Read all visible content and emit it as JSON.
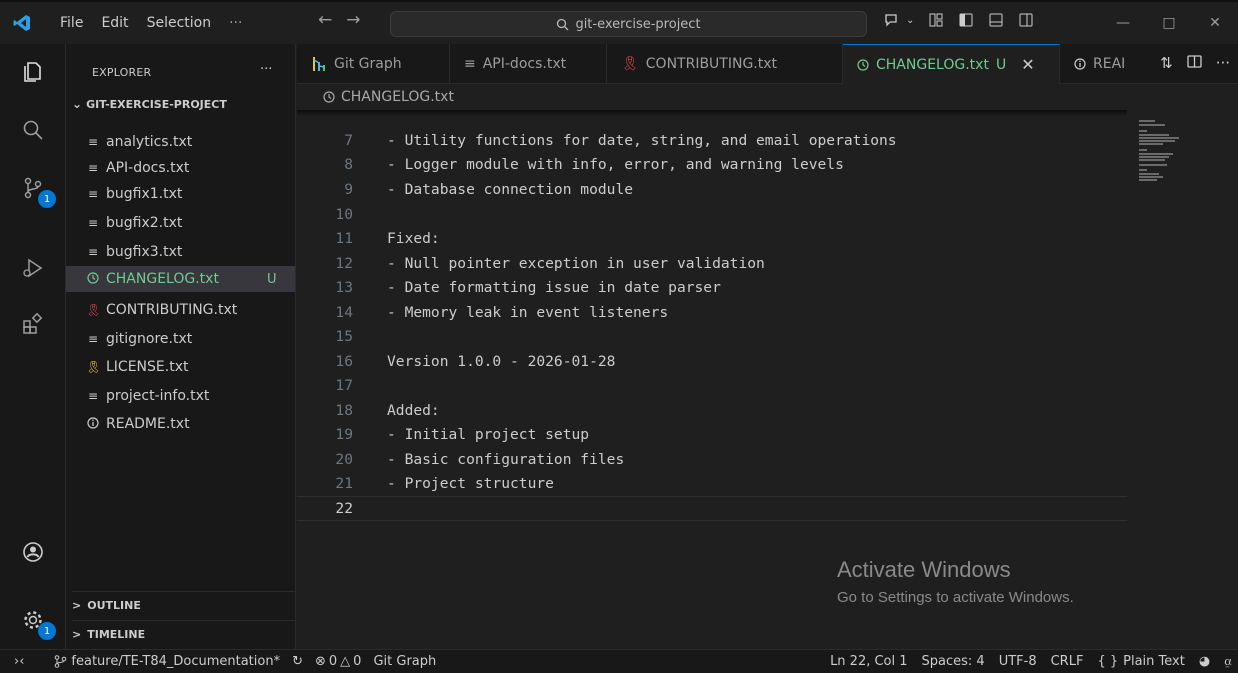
{
  "titlebar": {
    "menu": [
      "File",
      "Edit",
      "Selection",
      "···"
    ],
    "search_text": "git-exercise-project"
  },
  "activity": {
    "scm_badge": "1",
    "settings_badge": "1"
  },
  "explorer": {
    "header": "EXPLORER",
    "more": "···",
    "project": "GIT-EXERCISE-PROJECT",
    "files": [
      {
        "name": "analytics.txt",
        "icon": "text-lines-icon",
        "status": ""
      },
      {
        "name": "API-docs.txt",
        "icon": "text-lines-icon",
        "status": ""
      },
      {
        "name": "bugfix1.txt",
        "icon": "text-lines-icon",
        "status": ""
      },
      {
        "name": "bugfix2.txt",
        "icon": "text-lines-icon",
        "status": ""
      },
      {
        "name": "bugfix3.txt",
        "icon": "text-lines-icon",
        "status": ""
      },
      {
        "name": "CHANGELOG.txt",
        "icon": "clock-icon",
        "status": "U"
      },
      {
        "name": "CONTRIBUTING.txt",
        "icon": "ribbon-icon",
        "status": ""
      },
      {
        "name": "gitignore.txt",
        "icon": "text-lines-icon",
        "status": ""
      },
      {
        "name": "LICENSE.txt",
        "icon": "ribbon-icon",
        "status": ""
      },
      {
        "name": "project-info.txt",
        "icon": "text-lines-icon",
        "status": ""
      },
      {
        "name": "README.txt",
        "icon": "info-icon",
        "status": ""
      }
    ],
    "outline": "OUTLINE",
    "timeline": "TIMELINE"
  },
  "tabs": [
    {
      "label": "Git Graph",
      "icon": "git-graph-icon"
    },
    {
      "label": "API-docs.txt",
      "icon": "text-lines-icon"
    },
    {
      "label": "CONTRIBUTING.txt",
      "icon": "ribbon-icon"
    },
    {
      "label": "CHANGELOG.txt",
      "icon": "clock-icon",
      "status": "U"
    },
    {
      "label": "REAI",
      "icon": "info-icon"
    }
  ],
  "breadcrumb": "CHANGELOG.txt",
  "editor": {
    "lines": [
      {
        "n": "7",
        "text": "- Utility functions for date, string, and email operations"
      },
      {
        "n": "8",
        "text": "- Logger module with info, error, and warning levels"
      },
      {
        "n": "9",
        "text": "- Database connection module"
      },
      {
        "n": "10",
        "text": ""
      },
      {
        "n": "11",
        "text": "Fixed:"
      },
      {
        "n": "12",
        "text": "- Null pointer exception in user validation"
      },
      {
        "n": "13",
        "text": "- Date formatting issue in date parser"
      },
      {
        "n": "14",
        "text": "- Memory leak in event listeners"
      },
      {
        "n": "15",
        "text": ""
      },
      {
        "n": "16",
        "text": "Version 1.0.0 - 2026-01-28"
      },
      {
        "n": "17",
        "text": ""
      },
      {
        "n": "18",
        "text": "Added:"
      },
      {
        "n": "19",
        "text": "- Initial project setup"
      },
      {
        "n": "20",
        "text": "- Basic configuration files"
      },
      {
        "n": "21",
        "text": "- Project structure"
      },
      {
        "n": "22",
        "text": ""
      }
    ],
    "current_line": "22"
  },
  "watermark": {
    "title": "Activate Windows",
    "subtitle": "Go to Settings to activate Windows."
  },
  "statusbar": {
    "branch": "feature/TE-T84_Documentation*",
    "errors": "0",
    "warnings": "0",
    "git_graph": "Git Graph",
    "position": "Ln 22, Col 1",
    "spaces": "Spaces: 4",
    "encoding": "UTF-8",
    "eol": "CRLF",
    "language": "Plain Text"
  },
  "colors": {
    "accent": "#0078d4",
    "untracked": "#73c991",
    "ribbon_red": "#e04848",
    "ribbon_yellow": "#e2c541"
  }
}
